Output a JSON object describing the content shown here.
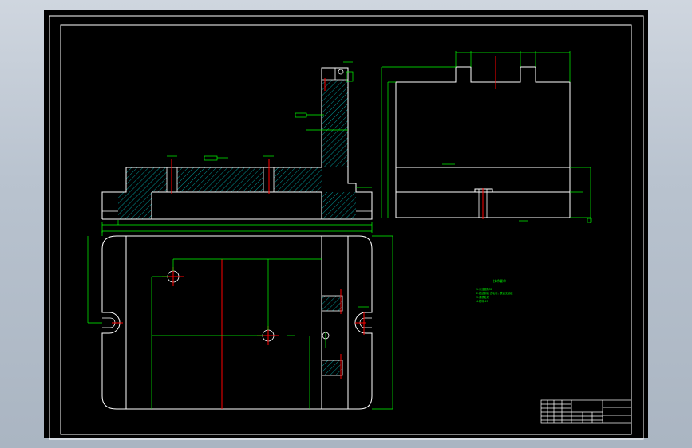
{
  "app": {
    "window_title": ""
  },
  "colors": {
    "background": "#000000",
    "outline": "#ffffff",
    "dimension": "#00ff00",
    "centerline": "#ff0000",
    "hatch": "#00ffff",
    "frame_outer": "#ffffff"
  },
  "views": {
    "front": {
      "name": "front-section-view"
    },
    "side": {
      "name": "side-view"
    },
    "top": {
      "name": "plan-view"
    }
  },
  "tech_notes": {
    "title": "技术要求",
    "lines": [
      "1.未注圆角R2",
      "2.锐边倒钝 去毛刺，表面无划痕",
      "3.调质处理",
      "4.材料 45"
    ]
  },
  "title_block": {
    "rows": 6
  }
}
